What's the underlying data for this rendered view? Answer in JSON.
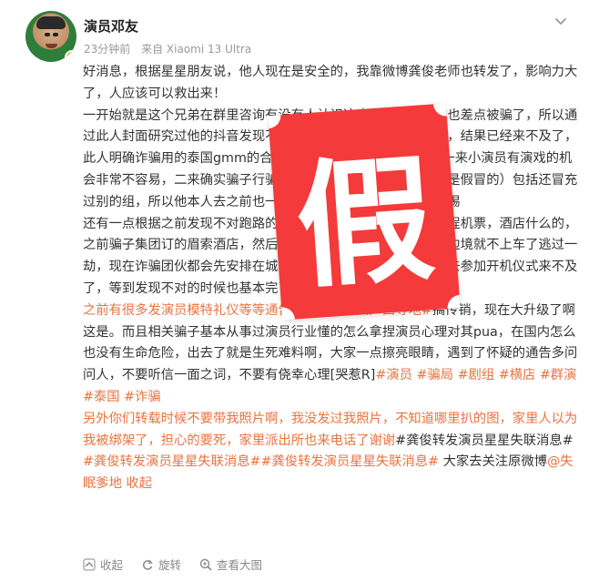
{
  "post": {
    "author": "演员邓友",
    "time": "23分钟前",
    "source": "来自 Xiaomi 13 Ultra",
    "paragraphs": [
      [
        {
          "t": "好消息，根据星星朋友说，他人现在是安全的，我靠微博龚俊老师也转发了，影响力大了，人应该可以救出来！",
          "tag": false
        }
      ],
      [
        {
          "t": "一开始就是这个兄弟在群里咨询有没有人认识这个十六，我当时也差点被骗了，所以通过此人封面研究过他的抖音发现不对，说了很不靠谱，劝不要去，结果已经来不及了，此人明确诈骗用的泰国gmm的合同，小演员也没有备案意识，一来小演员有演戏的机会非常不容易，二来确实骗子行骗的手段作品备案等等（当然都是假冒的）包括还冒充过别的组，所以他本人去之前也一查确实在泰国拍所以放松了警惕",
          "tag": false
        }
      ],
      [
        {
          "t": "还有一点根据之前发现不对跑路的一位演员说的，他刚好订好返程机票，酒店什么的，之前骗子集团订的眉索酒店，然后有一个小演员一看酒店在泰缅边境就不上车了逃过一劫，现在诈骗团伙都会先安排在城市附近酒店，然后拉上你说先去参加开机仪式来不及了，等到发现不对的时候也基本完了，防不胜防啊。",
          "tag": false
        },
        {
          "t": "#诈骗",
          "tag": true
        }
      ],
      [
        {
          "t": "之前有很多发演员模特礼仪等等通告将人骗到陕西广西等地#",
          "tag": true
        },
        {
          "t": "搞传销，现在大升级了啊这是。而且相关骗子基本从事过演员行业懂的怎么拿捏演员心理对其pua，在国内怎么也没有生命危险，出去了就是生死难料啊，大家一点擦亮眼睛，遇到了怀疑的通告多问问人，不要听信一面之词，不要有侥幸心理[哭惹R]",
          "tag": false
        },
        {
          "t": "#演员",
          "tag": true
        },
        {
          "t": " ",
          "tag": false
        },
        {
          "t": "#骗局",
          "tag": true
        },
        {
          "t": " ",
          "tag": false
        },
        {
          "t": "#剧组",
          "tag": true
        },
        {
          "t": " ",
          "tag": false
        },
        {
          "t": "#横店",
          "tag": true
        },
        {
          "t": " ",
          "tag": false
        },
        {
          "t": "#群演",
          "tag": true
        },
        {
          "t": " ",
          "tag": false
        },
        {
          "t": "#泰国",
          "tag": true
        },
        {
          "t": " ",
          "tag": false
        },
        {
          "t": "#诈骗",
          "tag": true
        }
      ],
      [
        {
          "t": "另外你们转载时候不要带我照片啊，我没发过我照片，不知道哪里扒的图，家里人以为我被绑架了，担心的要死，家里派出所也来电话了谢谢",
          "tag": true
        },
        {
          "t": "#龚俊转发演员星星失联消息#",
          "tag": false
        },
        {
          "t": "#龚俊转发演员星星失联消息##龚俊转发演员星星失联消息#",
          "tag": true
        },
        {
          "t": " 大家去关注原微博",
          "tag": false
        },
        {
          "t": "@失眠爹地",
          "tag": true
        },
        {
          "t": " 收起",
          "tag": true
        }
      ]
    ]
  },
  "stamp": {
    "char": "假",
    "color": "#f43a3a"
  },
  "footer": {
    "collect": "收起",
    "repost": "旋转",
    "view_large": "查看大图"
  },
  "icons": {
    "chevron": "chevron-down-icon",
    "collect": "collapse-icon",
    "rotate": "rotate-icon",
    "zoom": "zoom-icon"
  },
  "colors": {
    "accent": "#eb7340",
    "text": "#333333",
    "meta": "#999999"
  }
}
